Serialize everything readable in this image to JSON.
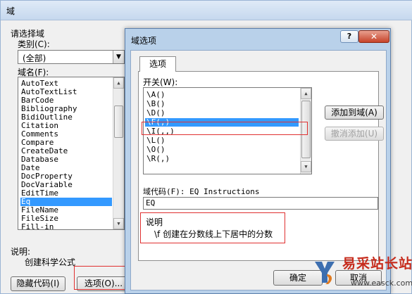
{
  "main_dialog": {
    "title": "域",
    "choose_field_label": "请选择域",
    "category_label": "类别(C):",
    "category_value": "(全部)",
    "field_names_label": "域名(F):",
    "field_names": [
      "AutoText",
      "AutoTextList",
      "BarCode",
      "Bibliography",
      "BidiOutline",
      "Citation",
      "Comments",
      "Compare",
      "CreateDate",
      "Database",
      "Date",
      "DocProperty",
      "DocVariable",
      "EditTime",
      "Eq",
      "FileName",
      "FileSize",
      "Fill-in"
    ],
    "selected_field": "Eq",
    "description_label": "说明:",
    "description_text": "创建科学公式",
    "hide_codes_button": "隐藏代码(I)",
    "options_button": "选项(O)..."
  },
  "options_dialog": {
    "title": "域选项",
    "help_label": "?",
    "close_label": "✕",
    "tab_label": "选项",
    "switches_label": "开关(W):",
    "switches": [
      "\\A()",
      "\\B()",
      "\\D()",
      "\\F(,)",
      "\\I(,,)",
      "\\L()",
      "\\O()",
      "\\R(,)"
    ],
    "selected_switch": "\\F(,)",
    "add_to_field_button": "添加到域(A)",
    "undo_add_button": "撤消添加(U)",
    "field_code_label": "域代码(F): EQ Instructions",
    "field_code_value": "EQ",
    "info_label": "说明",
    "info_text": "\\f 创建在分数线上下居中的分数",
    "ok_button": "确定",
    "cancel_button": "取消"
  },
  "watermark": {
    "site_name": "易采站长站",
    "url": "www.easck.com"
  },
  "colors": {
    "selection": "#3399ff",
    "highlight_box": "#e03030",
    "watermark_red": "#c62b1c"
  }
}
